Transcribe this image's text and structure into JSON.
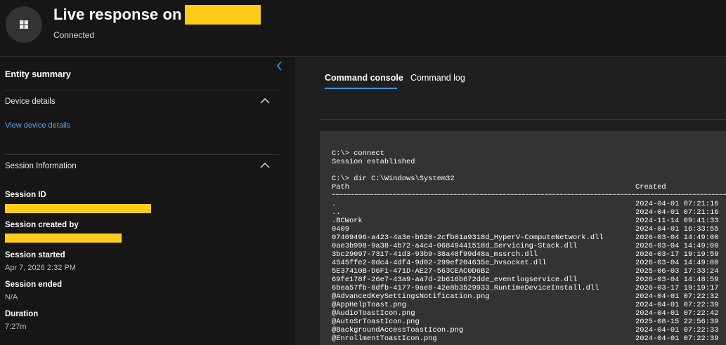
{
  "header": {
    "title": "Live response on",
    "status": "Connected",
    "os_icon": "windows-icon"
  },
  "sidebar": {
    "collapse_icon": "chevron-left-icon",
    "entity_summary": "Entity summary",
    "device_details": {
      "title": "Device details",
      "link": "View device details"
    },
    "session_information": {
      "title": "Session Information",
      "session_id_label": "Session ID",
      "session_created_by_label": "Session created by",
      "session_started_label": "Session started",
      "session_started_value": "Apr 7, 2026 2:32 PM",
      "session_ended_label": "Session ended",
      "session_ended_value": "N/A",
      "duration_label": "Duration",
      "duration_value": "7:27m"
    }
  },
  "tabs": [
    {
      "label": "Command console",
      "active": true
    },
    {
      "label": "Command log",
      "active": false
    }
  ],
  "console": {
    "lines": [
      "C:\\> connect",
      "Session established",
      "",
      "C:\\> dir C:\\Windows\\System32"
    ],
    "col_path": "Path",
    "col_created": "Created",
    "separator": "================================================================================================================================",
    "rows": [
      {
        "name": ".",
        "created": "2024-04-01 07:21:16"
      },
      {
        "name": "..",
        "created": "2024-04-01 07:21:16"
      },
      {
        "name": ".BCWork",
        "created": "2024-11-14 09:41:33"
      },
      {
        "name": "0409",
        "created": "2024-04-01 16:33:55"
      },
      {
        "name": "07409496-a423-4a3e-b620-2cfb01a9318d_HyperV-ComputeNetwork.dll",
        "created": "2026-03-04 14:49:00"
      },
      {
        "name": "0ae3b998-9a38-4b72-a4c4-06849441518d_Servicing-Stack.dll",
        "created": "2026-03-04 14:49:00"
      },
      {
        "name": "3bc29097-7317-41d3-93b9-38a48f99d48a_mssrch.dll",
        "created": "2026-03-17 19:19:59"
      },
      {
        "name": "4545ffe2-0dc4-4df4-9d02-299ef204635e_hvsocket.dll",
        "created": "2026-03-04 14:49:00"
      },
      {
        "name": "5E37410B-D6F1-471D-AE27-563CEAC0D6B2",
        "created": "2025-06-03 17:33:24"
      },
      {
        "name": "69fe178f-26e7-43a9-aa7d-2b616b672dde_eventlogservice.dll",
        "created": "2026-03-04 14:48:59"
      },
      {
        "name": "6bea57fb-8dfb-4177-9ae8-42e8b3529933_RuntimeDeviceInstall.dll",
        "created": "2026-03-17 19:19:17"
      },
      {
        "name": "@AdvancedKeySettingsNotification.png",
        "created": "2024-04-01 07:22:32"
      },
      {
        "name": "@AppHelpToast.png",
        "created": "2024-04-01 07:22:39"
      },
      {
        "name": "@AudioToastIcon.png",
        "created": "2024-04-01 07:22:42"
      },
      {
        "name": "@AutoSrToastIcon.png",
        "created": "2025-08-15 22:56:39"
      },
      {
        "name": "@BackgroundAccessToastIcon.png",
        "created": "2024-04-01 07:22:33"
      },
      {
        "name": "@EnrollmentToastIcon.png",
        "created": "2024-04-01 07:22:39"
      }
    ]
  },
  "colors": {
    "background": "#161616",
    "console_bg": "#333333",
    "accent": "#3c93dc",
    "link": "#58a6e8",
    "redaction": "#ffcc1a"
  }
}
